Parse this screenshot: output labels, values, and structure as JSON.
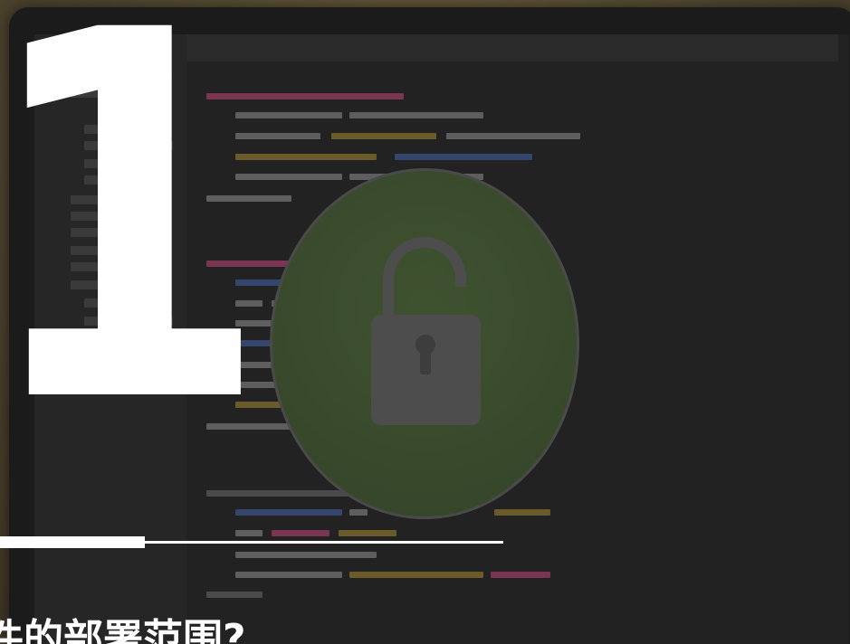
{
  "hero": {
    "number": "1",
    "headline": "件的部署范围?"
  },
  "illustration": {
    "icon": "unlocked-padlock-icon",
    "colors": {
      "lock_circle": "#384a2b",
      "lock_glyph": "#4d4d4d",
      "code_pink": "#7a3550",
      "code_gold": "#6b5a2a",
      "code_blue": "#34466b"
    }
  }
}
